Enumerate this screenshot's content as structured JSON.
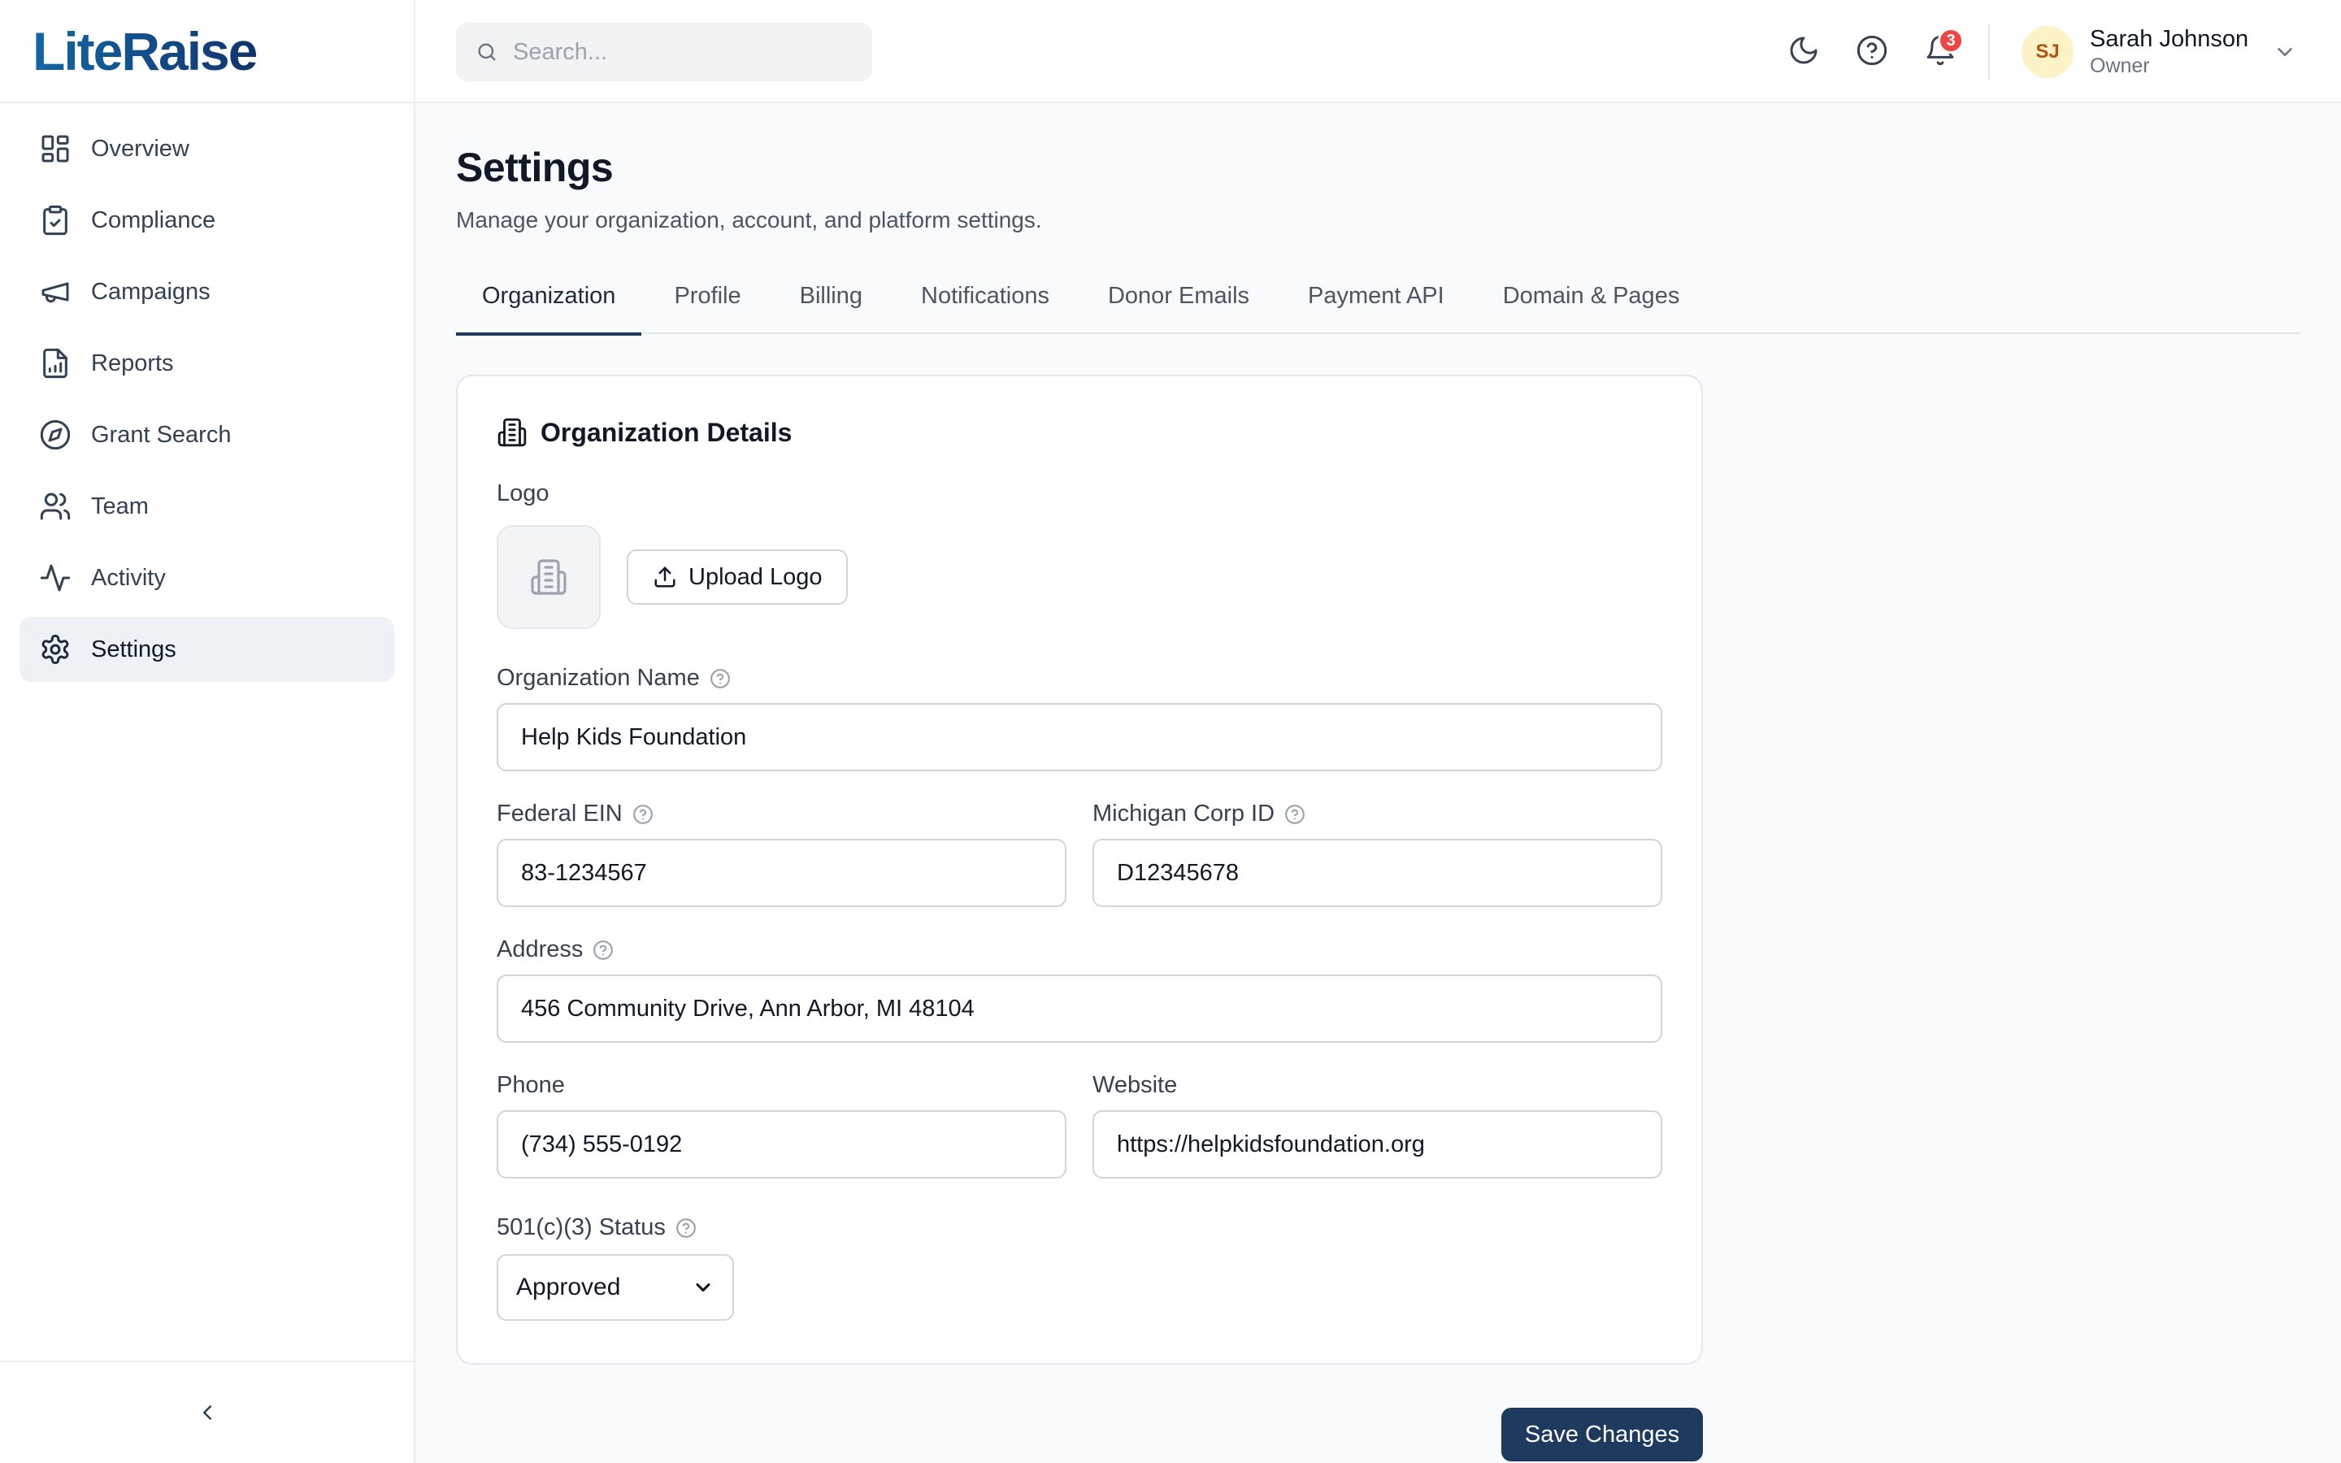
{
  "brand": {
    "name": "LiteRaise"
  },
  "sidebar": {
    "items": [
      {
        "label": "Overview",
        "icon": "grid-icon"
      },
      {
        "label": "Compliance",
        "icon": "clipboard-check-icon"
      },
      {
        "label": "Campaigns",
        "icon": "megaphone-icon"
      },
      {
        "label": "Reports",
        "icon": "file-chart-icon"
      },
      {
        "label": "Grant Search",
        "icon": "compass-icon"
      },
      {
        "label": "Team",
        "icon": "users-icon"
      },
      {
        "label": "Activity",
        "icon": "activity-icon"
      },
      {
        "label": "Settings",
        "icon": "gear-icon",
        "active": true
      }
    ],
    "collapse_icon": "chevron-left-icon"
  },
  "topbar": {
    "search_placeholder": "Search...",
    "notification_count": "3",
    "user": {
      "initials": "SJ",
      "name": "Sarah Johnson",
      "role": "Owner"
    }
  },
  "page": {
    "title": "Settings",
    "subtitle": "Manage your organization, account, and platform settings."
  },
  "tabs": [
    {
      "label": "Organization",
      "active": true
    },
    {
      "label": "Profile"
    },
    {
      "label": "Billing"
    },
    {
      "label": "Notifications"
    },
    {
      "label": "Donor Emails"
    },
    {
      "label": "Payment API"
    },
    {
      "label": "Domain & Pages"
    }
  ],
  "org_card": {
    "title": "Organization Details",
    "logo_label": "Logo",
    "upload_label": "Upload Logo",
    "fields": {
      "org_name": {
        "label": "Organization Name",
        "value": "Help Kids Foundation"
      },
      "ein": {
        "label": "Federal EIN",
        "value": "83-1234567"
      },
      "corp_id": {
        "label": "Michigan Corp ID",
        "value": "D12345678"
      },
      "address": {
        "label": "Address",
        "value": "456 Community Drive, Ann Arbor, MI 48104"
      },
      "phone": {
        "label": "Phone",
        "value": "(734) 555-0192"
      },
      "website": {
        "label": "Website",
        "value": "https://helpkidsfoundation.org"
      },
      "status": {
        "label": "501(c)(3) Status",
        "value": "Approved"
      }
    }
  },
  "actions": {
    "save_label": "Save Changes"
  },
  "colors": {
    "accent": "#1e3a5f",
    "badge": "#ef4444",
    "active_nav_bg": "#eef2f6"
  }
}
